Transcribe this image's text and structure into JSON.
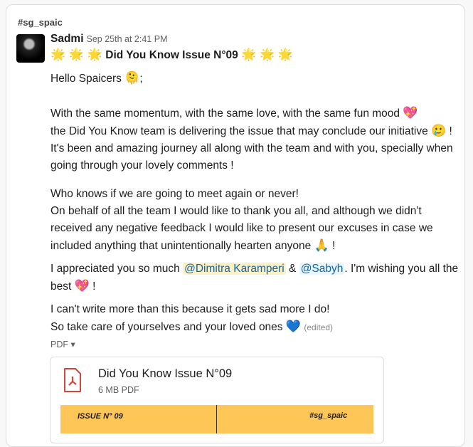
{
  "channel": "#sg_spaic",
  "message": {
    "author": "Sadmi",
    "timestamp": "Sep 25th at 2:41 PM",
    "stars": "🌟 🌟 🌟",
    "title": "Did You Know Issue N°09",
    "stars_after": "🌟 🌟 🌟",
    "greeting": "Hello Spaicers",
    "greeting_emoji": "🫠",
    "greeting_end": ";",
    "p1a": "With the same momentum, with the same love, with the same fun mood",
    "p1_emoji1": "💖",
    "p1b": " the Did You Know team is delivering the issue that may conclude our initiative",
    "p1_emoji2": "🥲",
    "p1c": " ! It's been and amazing journey all along with the team and with you, specially when going through your lovely comments !",
    "p2a": "Who knows if we are going to meet again or never!",
    "p2b": "On behalf of all the team I would like to thank you all, and although we didn't received any negative feedback I would like to present our excuses in case we included anything that unintentionally hearten anyone ",
    "p2_emoji": "🙏",
    "p2_end": " !",
    "p3a": "I appreciated you so much ",
    "mention1": "@Dimitra Karamperi",
    "p3amp": " & ",
    "mention2": "@Sabyh",
    "p3b": ". I'm wishing you all the best ",
    "p3_emoji": "💖",
    "p3_end": " !",
    "p4a": "I can't write more than this because it gets sad more I do!",
    "p4b": "So take care of yourselves and your loved ones ",
    "p4_emoji": "💙",
    "edited": "(edited)",
    "attachment_label": "PDF ▾"
  },
  "file": {
    "name": "Did You Know Issue N°09",
    "size": "6 MB PDF",
    "preview_left": "ISSUE N° 09",
    "preview_right": "#sg_spaic"
  }
}
